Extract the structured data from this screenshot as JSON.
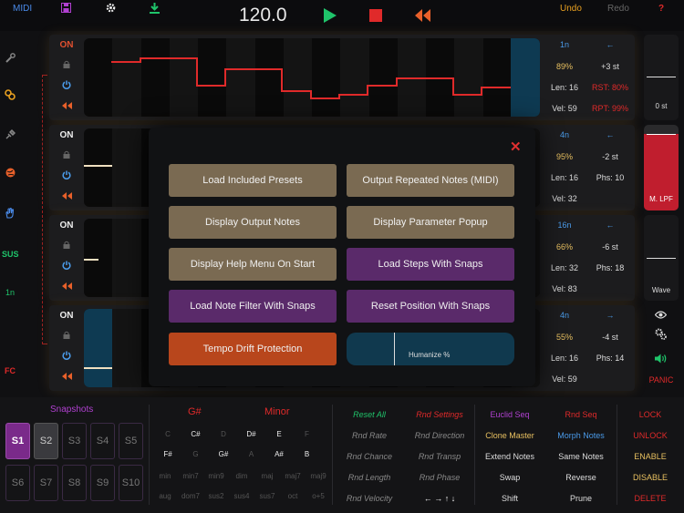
{
  "top": {
    "midi": "MIDI",
    "tempo": "120.0",
    "undo": "Undo",
    "redo": "Redo",
    "help": "?",
    "colors": {
      "play": "#1fc46a",
      "stop": "#e02a2a",
      "rewind": "#e8602a",
      "accent": "#e8a020"
    }
  },
  "sidebar": {
    "sus": "SUS",
    "rate": "1n",
    "fc": "FC"
  },
  "tracks": [
    {
      "on": "ON",
      "rate": "1n",
      "pct": "89%",
      "transpose": "+3 st",
      "len": "Len: 16",
      "extra": "RST: 80%",
      "vel": "Vel: 59",
      "extra2": "RPT: 99%",
      "direction": "←",
      "on_color": "#e05030"
    },
    {
      "on": "ON",
      "rate": "4n",
      "pct": "95%",
      "transpose": "-2 st",
      "len": "Len: 16",
      "extra": "Phs: 10",
      "vel": "Vel: 32",
      "extra2": "",
      "direction": "←",
      "on_color": "#eeeeee"
    },
    {
      "on": "ON",
      "rate": "16n",
      "pct": "66%",
      "transpose": "-6 st",
      "len": "Len: 32",
      "extra": "Phs: 18",
      "vel": "Vel: 83",
      "extra2": "",
      "direction": "←",
      "on_color": "#eeeeee"
    },
    {
      "on": "ON",
      "rate": "4n",
      "pct": "55%",
      "transpose": "-4 st",
      "len": "Len: 16",
      "extra": "Phs: 14",
      "vel": "Vel: 59",
      "extra2": "",
      "direction": "→",
      "on_color": "#eeeeee"
    }
  ],
  "right": {
    "st_label": "0 st",
    "lpf_label": "M. LPF",
    "wave_label": "Wave",
    "panic": "PANIC"
  },
  "modal": {
    "buttons": [
      "Load Included Presets",
      "Output Repeated Notes (MIDI)",
      "Display Output Notes",
      "Display Parameter Popup",
      "Display Help Menu On Start",
      "Load Steps With Snaps",
      "Load Note Filter With Snaps",
      "Reset Position With Snaps",
      "Tempo Drift Protection"
    ],
    "humanize_label": "Humanize %",
    "humanize_value": 0.28
  },
  "snapshots": {
    "title": "Snapshots",
    "items": [
      "S1",
      "S2",
      "S3",
      "S4",
      "S5",
      "S6",
      "S7",
      "S8",
      "S9",
      "S10"
    ]
  },
  "scale": {
    "root": "G#",
    "mode": "Minor",
    "notes": [
      "C",
      "C#",
      "D",
      "D#",
      "E",
      "F",
      "F#",
      "G",
      "G#",
      "A",
      "A#",
      "B"
    ],
    "chords_row1": [
      "min",
      "min7",
      "min9",
      "dim",
      "maj",
      "maj7",
      "maj9"
    ],
    "chords_row2": [
      "aug",
      "dom7",
      "sus2",
      "sus4",
      "sus7",
      "oct",
      "o+5"
    ]
  },
  "random": {
    "col1": [
      "Reset All",
      "Rnd Rate",
      "Rnd Chance",
      "Rnd Length",
      "Rnd Velocity"
    ],
    "col2": [
      "Rnd Settings",
      "Rnd Direction",
      "Rnd Transp",
      "Rnd Phase",
      "← → ↑ ↓"
    ]
  },
  "seq": {
    "col1": [
      "Euclid Seq",
      "Clone Master",
      "Extend Notes",
      "Swap",
      "Shift"
    ],
    "col2": [
      "Rnd Seq",
      "Morph Notes",
      "Same Notes",
      "Reverse",
      "Prune"
    ]
  },
  "lock": [
    "LOCK",
    "UNLOCK",
    "ENABLE",
    "DISABLE",
    "DELETE"
  ]
}
